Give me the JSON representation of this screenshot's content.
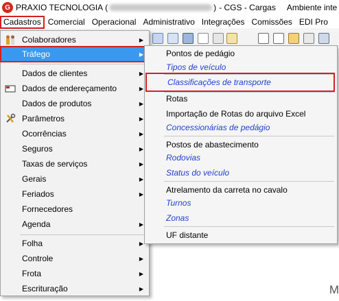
{
  "title": {
    "company": "PRAXIO TECNOLOGIA",
    "open_paren": "(",
    "close_paren": ")",
    "suffix": "- CGS - Cargas",
    "environment": "Ambiente inte"
  },
  "menubar": {
    "items": [
      "Cadastros",
      "Comercial",
      "Operacional",
      "Administrativo",
      "Integrações",
      "Comissões",
      "EDI Pro"
    ]
  },
  "main_menu": {
    "items": [
      {
        "label": "Colaboradores",
        "submenu": true,
        "icon": "people-icon"
      },
      {
        "label": "Tráfego",
        "submenu": true,
        "highlighted": true
      },
      {
        "label": "Dados de clientes",
        "submenu": true
      },
      {
        "label": "Dados de endereçamento",
        "submenu": true,
        "icon": "envelope-icon"
      },
      {
        "label": "Dados de produtos",
        "submenu": true
      },
      {
        "label": "Parâmetros",
        "submenu": true,
        "icon": "tools-icon"
      },
      {
        "label": "Ocorrências",
        "submenu": true
      },
      {
        "label": "Seguros",
        "submenu": true
      },
      {
        "label": "Taxas de serviços",
        "submenu": true
      },
      {
        "label": "Gerais",
        "submenu": true
      },
      {
        "label": "Feriados",
        "submenu": true
      },
      {
        "label": "Fornecedores",
        "submenu": false
      },
      {
        "label": "Agenda",
        "submenu": true
      },
      {
        "label": "Folha",
        "submenu": true
      },
      {
        "label": "Controle",
        "submenu": true
      },
      {
        "label": "Frota",
        "submenu": true
      },
      {
        "label": "Escrituração",
        "submenu": true
      }
    ]
  },
  "sub_menu": {
    "items": [
      {
        "label": "Pontos de pedágio",
        "italic": false
      },
      {
        "label": "Tipos de veículo",
        "italic": true
      },
      {
        "label": "Classificações de transporte",
        "italic": true,
        "boxed": true
      },
      {
        "label": "Rotas",
        "italic": false
      },
      {
        "label": "Importação de Rotas do arquivo Excel",
        "italic": false
      },
      {
        "label": "Concessionárias de pedágio",
        "italic": true
      },
      {
        "label": "Postos de abastecimento",
        "italic": false
      },
      {
        "label": "Rodovias",
        "italic": true
      },
      {
        "label": "Status do veículo",
        "italic": true
      },
      {
        "label": "Atrelamento da carreta no cavalo",
        "italic": false
      },
      {
        "label": "Turnos",
        "italic": true
      },
      {
        "label": "Zonas",
        "italic": true
      },
      {
        "label": "UF distante",
        "italic": false
      }
    ]
  },
  "icons": {
    "submenu_arrow": "triangle-right-icon",
    "app_logo": "praxio-logo-icon"
  },
  "colors": {
    "highlight": "#3a99ee",
    "red_box": "#d42020",
    "italic_link": "#1f3fd0"
  },
  "corner_glyph": "M"
}
